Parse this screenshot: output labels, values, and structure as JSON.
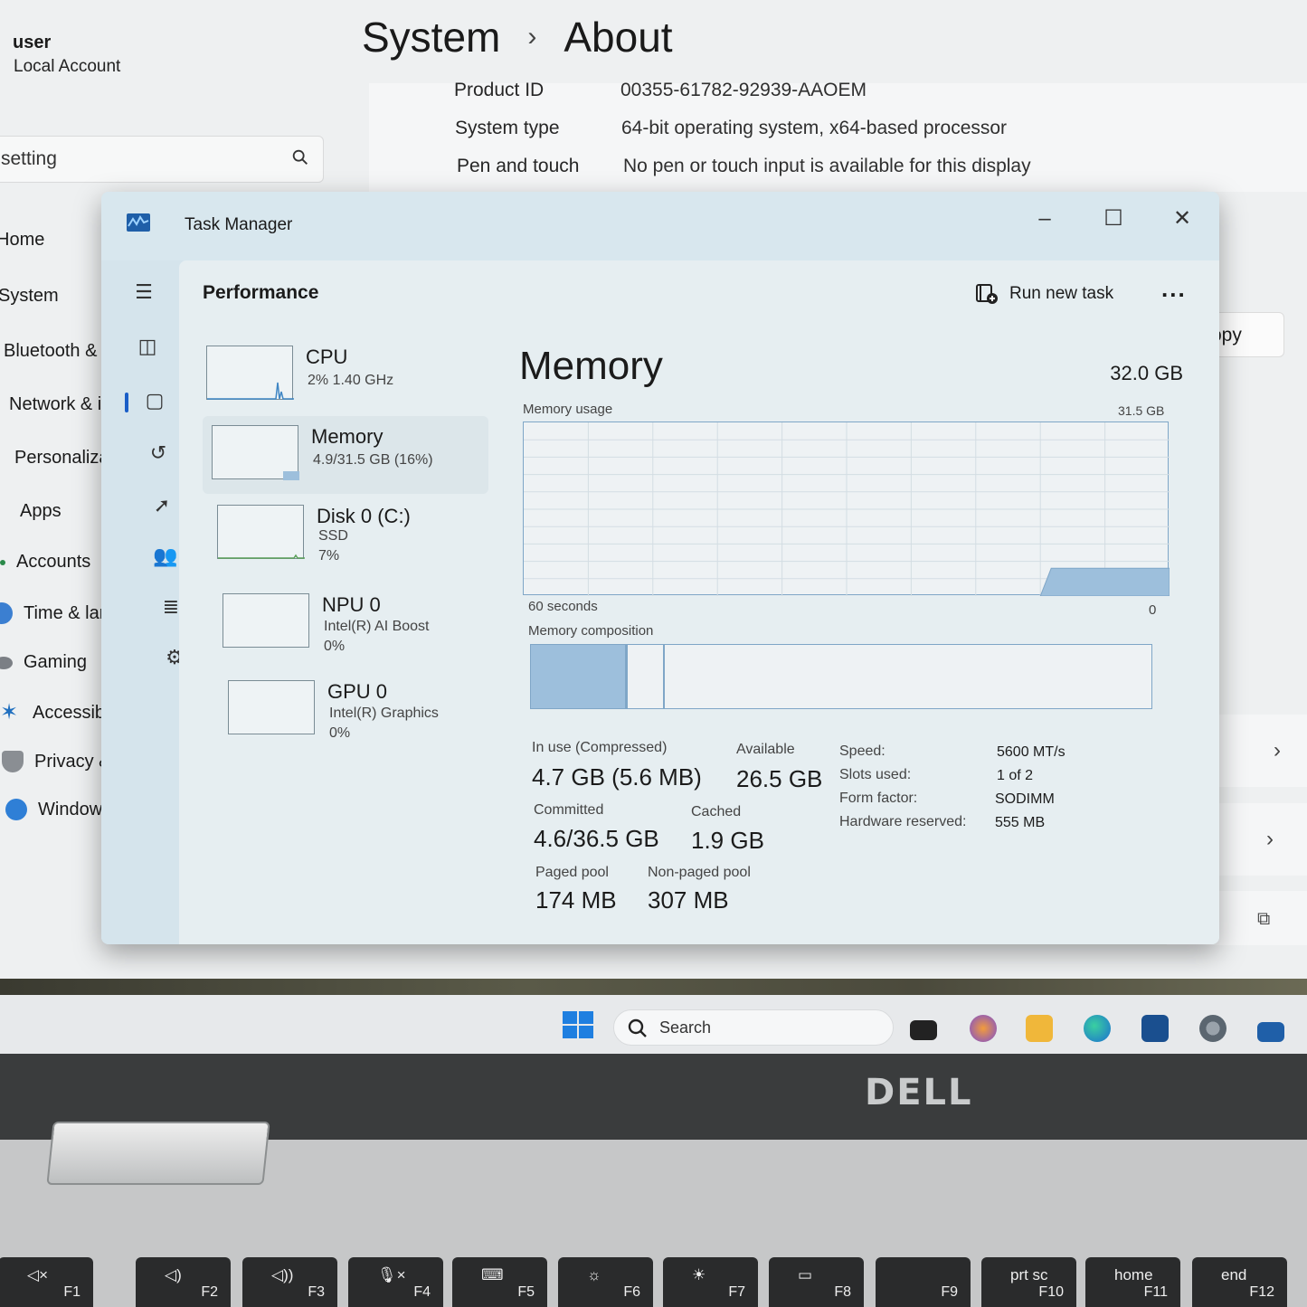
{
  "settings": {
    "user_name": "user",
    "user_account": "Local Account",
    "breadcrumb_parent": "System",
    "breadcrumb_sep": "›",
    "breadcrumb_current": "About",
    "search_text": "setting",
    "nav": [
      "Home",
      "System",
      "Bluetooth &",
      "Network & ir",
      "Personalizati",
      "Apps",
      "Accounts",
      "Time & langu",
      "Gaming",
      "Accessibility",
      "Privacy & sec",
      "Windows Up"
    ],
    "info": [
      {
        "key": "Product ID",
        "value": "00355-61782-92939-AAOEM"
      },
      {
        "key": "System type",
        "value": "64-bit operating system, x64-based processor"
      },
      {
        "key": "Pen and touch",
        "value": "No pen or touch input is available for this display"
      }
    ],
    "copy_label": "opy"
  },
  "taskmanager": {
    "title": "Task Manager",
    "page_title": "Performance",
    "run_new_task": "Run new task",
    "more": "...",
    "devices": [
      {
        "name": "CPU",
        "sub1": "2% 1.40 GHz",
        "sub2": ""
      },
      {
        "name": "Memory",
        "sub1": "4.9/31.5 GB (16%)",
        "sub2": ""
      },
      {
        "name": "Disk 0 (C:)",
        "sub1": "SSD",
        "sub2": "7%"
      },
      {
        "name": "NPU 0",
        "sub1": "Intel(R) AI Boost",
        "sub2": "0%"
      },
      {
        "name": "GPU 0",
        "sub1": "Intel(R) Graphics",
        "sub2": "0%"
      }
    ],
    "memory": {
      "title": "Memory",
      "total": "32.0 GB",
      "usage_label": "Memory usage",
      "usage_max": "31.5 GB",
      "time_label": "60 seconds",
      "time_end": "0",
      "composition_label": "Memory composition",
      "usage_fraction": 0.16,
      "composition": {
        "in_use": 0.155,
        "modified": 0.005,
        "standby": 0.06
      },
      "stats": {
        "in_use_label": "In use (Compressed)",
        "in_use_value": "4.7 GB (5.6 MB)",
        "available_label": "Available",
        "available_value": "26.5 GB",
        "committed_label": "Committed",
        "committed_value": "4.6/36.5 GB",
        "cached_label": "Cached",
        "cached_value": "1.9 GB",
        "paged_label": "Paged pool",
        "paged_value": "174 MB",
        "nonpaged_label": "Non-paged pool",
        "nonpaged_value": "307 MB"
      },
      "specs": [
        {
          "key": "Speed:",
          "value": "5600 MT/s"
        },
        {
          "key": "Slots used:",
          "value": "1 of 2"
        },
        {
          "key": "Form factor:",
          "value": "SODIMM"
        },
        {
          "key": "Hardware reserved:",
          "value": "555 MB"
        }
      ]
    }
  },
  "taskbar": {
    "search_label": "Search"
  },
  "laptop": {
    "brand": "DELL",
    "keys": [
      {
        "icon": "◁×",
        "fn": "F1"
      },
      {
        "icon": "◁)",
        "fn": "F2"
      },
      {
        "icon": "◁))",
        "fn": "F3"
      },
      {
        "icon": "🎙×",
        "fn": "F4"
      },
      {
        "icon": "⌨",
        "fn": "F5"
      },
      {
        "icon": "☼",
        "fn": "F6"
      },
      {
        "icon": "☀",
        "fn": "F7"
      },
      {
        "icon": "▭",
        "fn": "F8"
      },
      {
        "icon": "",
        "fn": "F9"
      },
      {
        "icon": "prt sc",
        "fn": "F10"
      },
      {
        "icon": "home",
        "fn": "F11"
      },
      {
        "icon": "end",
        "fn": "F12"
      }
    ]
  },
  "colors": {
    "accent": "#1a5ec7",
    "memory_fill": "#9dbfdc",
    "memory_line": "#7fa6c7"
  }
}
